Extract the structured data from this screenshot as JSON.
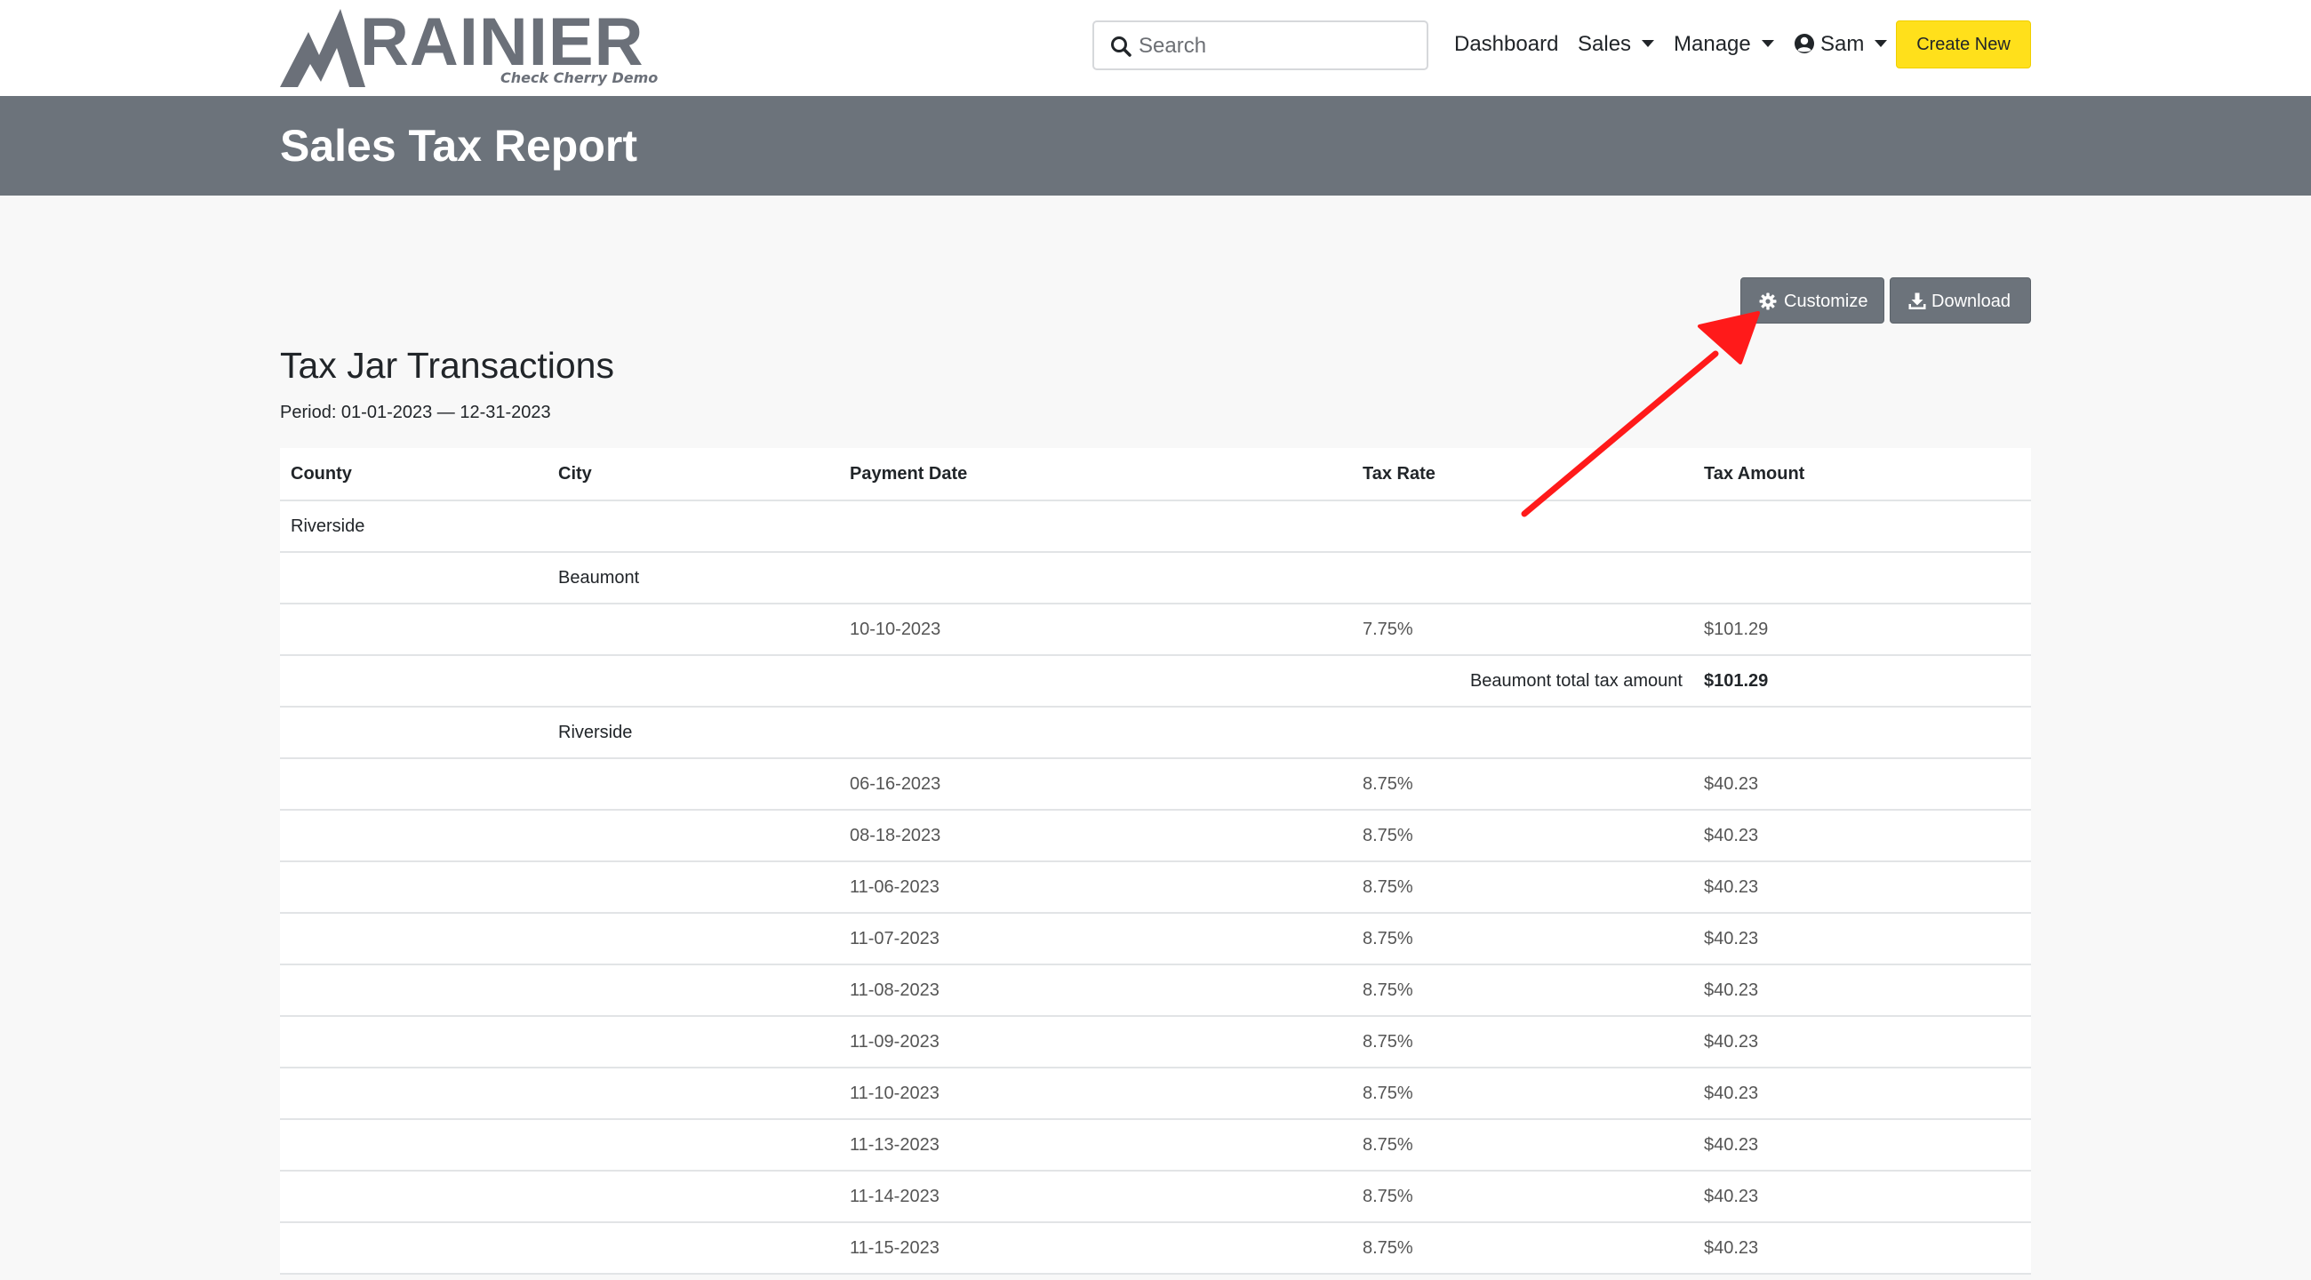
{
  "brand": {
    "name": "RAINIER",
    "tagline": "Check Cherry Demo",
    "logo_color": "#6b7079"
  },
  "nav": {
    "search_placeholder": "Search",
    "items": [
      {
        "label": "Dashboard"
      },
      {
        "label": "Sales"
      },
      {
        "label": "Manage"
      },
      {
        "label": "Sam"
      }
    ],
    "create_label": "Create New",
    "create_color": "#ffe01b"
  },
  "page": {
    "title": "Sales Tax Report",
    "band_color": "#6c737b"
  },
  "actions": {
    "customize_label": "Customize",
    "download_label": "Download"
  },
  "report": {
    "title": "Tax Jar Transactions",
    "period": "Period: 01-01-2023 — 12-31-2023",
    "columns": [
      "County",
      "City",
      "Payment Date",
      "Tax Rate",
      "Tax Amount"
    ],
    "county": "Riverside",
    "cities": [
      {
        "name": "Beaumont",
        "rows": [
          {
            "date": "10-10-2023",
            "rate": "7.75%",
            "amount": "$101.29"
          }
        ],
        "total_label": "Beaumont total tax amount",
        "total_amount": "$101.29"
      },
      {
        "name": "Riverside",
        "rows": [
          {
            "date": "06-16-2023",
            "rate": "8.75%",
            "amount": "$40.23"
          },
          {
            "date": "08-18-2023",
            "rate": "8.75%",
            "amount": "$40.23"
          },
          {
            "date": "11-06-2023",
            "rate": "8.75%",
            "amount": "$40.23"
          },
          {
            "date": "11-07-2023",
            "rate": "8.75%",
            "amount": "$40.23"
          },
          {
            "date": "11-08-2023",
            "rate": "8.75%",
            "amount": "$40.23"
          },
          {
            "date": "11-09-2023",
            "rate": "8.75%",
            "amount": "$40.23"
          },
          {
            "date": "11-10-2023",
            "rate": "8.75%",
            "amount": "$40.23"
          },
          {
            "date": "11-13-2023",
            "rate": "8.75%",
            "amount": "$40.23"
          },
          {
            "date": "11-14-2023",
            "rate": "8.75%",
            "amount": "$40.23"
          },
          {
            "date": "11-15-2023",
            "rate": "8.75%",
            "amount": "$40.23"
          }
        ]
      }
    ]
  },
  "annotation": {
    "arrow_color": "#ff1a1a"
  }
}
